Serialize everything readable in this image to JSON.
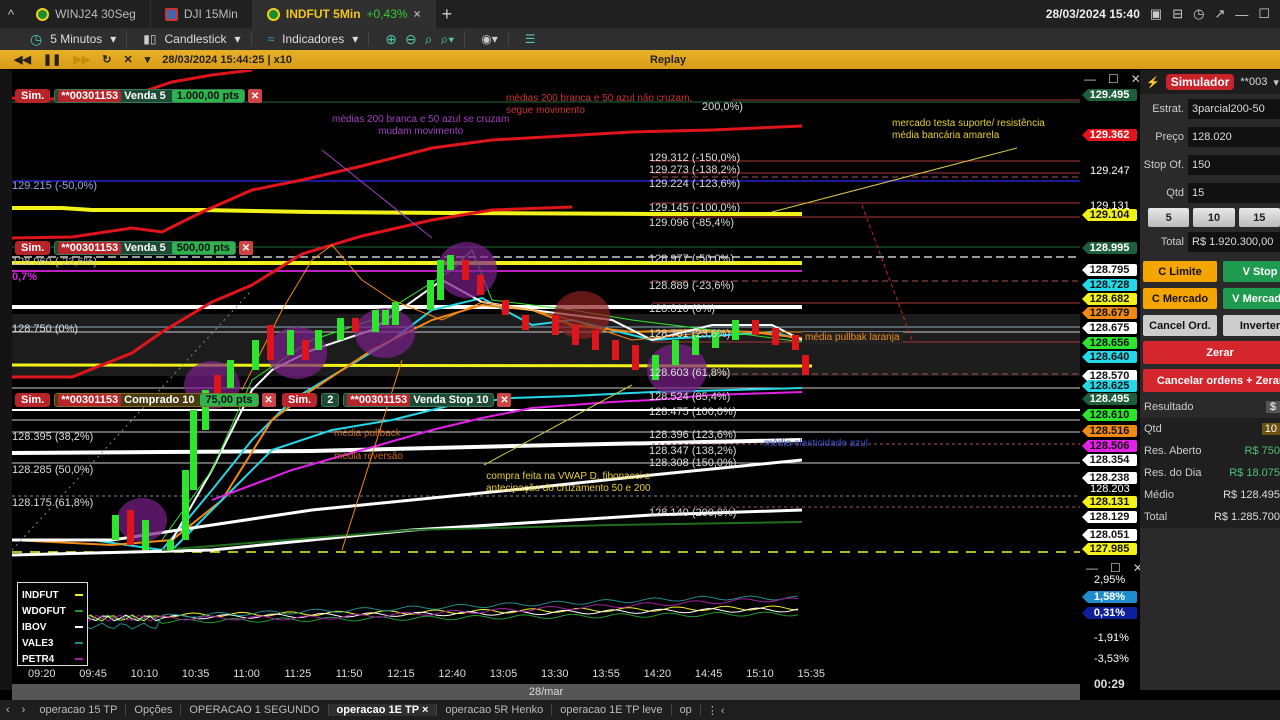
{
  "tabs": [
    {
      "label": "WINJ24 30Seg",
      "flag": "br"
    },
    {
      "label": "DJI 15Min",
      "flag": "us"
    },
    {
      "label": "INDFUT 5Min",
      "change": "+0,43%",
      "active": true,
      "flag": "br"
    }
  ],
  "header": {
    "datetime": "28/03/2024 15:40"
  },
  "toolbar": {
    "interval": "5 Minutos",
    "chart_type": "Candlestick",
    "indicators": "Indicadores"
  },
  "replay": {
    "timestamp": "28/03/2024 15:44:25 | x10",
    "title": "Replay"
  },
  "orders": [
    {
      "sim": "Sim.",
      "account": "**00301153",
      "label": "Venda 5",
      "pts": "1.000,00 pts"
    },
    {
      "sim": "Sim.",
      "account": "**00301153",
      "label": "Venda 5",
      "pts": "500,00 pts"
    },
    {
      "sim": "Sim.",
      "account": "**00301153",
      "label": "Comprado 10",
      "pts": "75,00 pts"
    },
    {
      "sim": "Sim.",
      "count": "2",
      "account": "**00301153",
      "label": "Venda Stop 10"
    }
  ],
  "fib_labels": [
    "129.215 (-50,0%)",
    "128.969 (-23,6%)",
    "0,7%",
    "128.750 (0%)",
    "128.395 (38,2%)",
    "128.285 (50,0%)",
    "128.175 (61,8%)",
    "200,0%)",
    "129.312 (-150,0%)",
    "129.273 (-138,2%)",
    "129.224 (-123,6%)",
    "129.145 (-100,0%)",
    "129.096 (-85,4%)",
    "128.977 (-50,0%)",
    "128.889 (-23,6%)",
    "128.810 (0%)",
    "128.731 (23,6%)",
    "128.603 (61,8%)",
    "128.524 (85,4%)",
    "128.475 (100,0%)",
    "128.396 (123,6%)",
    "128.347 (138,2%)",
    "128.308 (150,0%)",
    "128.140 (200,0%)"
  ],
  "annotations": {
    "a1": "médias 200 branca e 50 azul se cruzam\nmudam movimento",
    "a2": "médias 200 branca e 50 azul não cruzam,\nsegue movimento",
    "a3": "mercado testa suporte/ resistência\nmédia bancária amarela",
    "a4": "média pullbak laranja",
    "a5": "média pullback",
    "a6": "média reversão",
    "a7": "compra feita na VWAP D, fibonacci e\nantecipação do cruzamento 50 e 200",
    "a8": "média elasticidade azul"
  },
  "price_axis": [
    {
      "v": "129.495",
      "bg": "#1e5e3a",
      "fg": "#fff"
    },
    {
      "v": "129.362",
      "bg": "#e0151b",
      "fg": "#fff"
    },
    {
      "v": "129.247",
      "plain": true
    },
    {
      "v": "129.131",
      "plain": true
    },
    {
      "v": "129.104",
      "bg": "#f2f21a",
      "fg": "#111"
    },
    {
      "v": "128.995",
      "bg": "#1e5e3a",
      "fg": "#fff"
    },
    {
      "v": "128.795",
      "bg": "#fff",
      "fg": "#111"
    },
    {
      "v": "128.728",
      "bg": "#26d7e8",
      "fg": "#111"
    },
    {
      "v": "128.682",
      "bg": "#f2f21a",
      "fg": "#111"
    },
    {
      "v": "128.679",
      "bg": "#f08a14",
      "fg": "#111"
    },
    {
      "v": "128.675",
      "bg": "#fff",
      "fg": "#111"
    },
    {
      "v": "128.656",
      "bg": "#2ee52e",
      "fg": "#111"
    },
    {
      "v": "128.640",
      "bg": "#26d7e8",
      "fg": "#111"
    },
    {
      "v": "128.570",
      "bg": "#fff",
      "fg": "#111"
    },
    {
      "v": "128.625",
      "bg": "#26d7e8",
      "fg": "#111"
    },
    {
      "v": "128.495",
      "bg": "#1e5e3a",
      "fg": "#fff"
    },
    {
      "v": "128.610",
      "bg": "#2ee52e",
      "fg": "#111"
    },
    {
      "v": "128.516",
      "bg": "#f08a14",
      "fg": "#111"
    },
    {
      "v": "128.506",
      "bg": "#e41fe8",
      "fg": "#111"
    },
    {
      "v": "128.354",
      "bg": "#fff",
      "fg": "#111"
    },
    {
      "v": "128.238",
      "bg": "#fff",
      "fg": "#111"
    },
    {
      "v": "128.203",
      "plain": true
    },
    {
      "v": "128.131",
      "bg": "#f2f21a",
      "fg": "#111"
    },
    {
      "v": "128.129",
      "bg": "#fff",
      "fg": "#111"
    },
    {
      "v": "128.051",
      "bg": "#fff",
      "fg": "#111"
    },
    {
      "v": "127.985",
      "bg": "#f2f21a",
      "fg": "#111"
    }
  ],
  "indicator_axis": [
    {
      "v": "2,95%",
      "plain": true
    },
    {
      "v": "1,58%",
      "bg": "#1f8ccc",
      "fg": "#fff"
    },
    {
      "v": "0,31%",
      "bg": "#0f1f9a",
      "fg": "#fff"
    },
    {
      "v": "-1,91%",
      "plain": true
    },
    {
      "v": "-3,53%",
      "plain": true
    }
  ],
  "clock": "00:29",
  "legend": [
    {
      "name": "INDFUT",
      "color": "#f2f21a"
    },
    {
      "name": "WDOFUT",
      "color": "#1e9b30"
    },
    {
      "name": "IBOV",
      "color": "#ffffff"
    },
    {
      "name": "VALE3",
      "color": "#1f8c8c"
    },
    {
      "name": "PETR4",
      "color": "#a020a0"
    }
  ],
  "time_ticks": [
    "09:20",
    "09:45",
    "10:10",
    "10:35",
    "11:00",
    "11:25",
    "11:50",
    "12:15",
    "12:40",
    "13:05",
    "13:30",
    "13:55",
    "14:20",
    "14:45",
    "15:10",
    "15:35"
  ],
  "date": "28/mar",
  "panel": {
    "title": "Simulador",
    "account": "**003",
    "estrat_label": "Estrat.",
    "estrat": "3parcial200-50",
    "preco_label": "Preço",
    "preco": "128.020",
    "stop_label": "Stop Of.",
    "stop": "150",
    "qtd_label": "Qtd",
    "qtd": "15",
    "quick": [
      "5",
      "10",
      "15"
    ],
    "total_label": "Total",
    "total": "R$ 1.920.300,00",
    "c_limite": "C Limite",
    "v_stop": "V Stop",
    "c_mercado": "C Mercado",
    "v_mercado": "V Mercado",
    "cancel": "Cancel Ord.",
    "inverter": "Inverter",
    "zerar": "Zerar",
    "cancel_zerar": "Cancelar ordens + Zerar",
    "resultado": "Resultado",
    "res_unit": "$",
    "qtd2_label": "Qtd",
    "qtd2": "10",
    "aberto_label": "Res. Aberto",
    "aberto": "R$ 750",
    "dia_label": "Res. do Dia",
    "dia": "R$ 18.075",
    "medio_label": "Médio",
    "medio": "R$ 128.495",
    "total2_label": "Total",
    "total2": "R$ 1.285.700"
  },
  "bottom_tabs": [
    "operacao 15 TP",
    "Opções",
    "OPERACAO 1 SEGUNDO",
    "operacao 1E TP",
    "operacao 5R Henko",
    "operacao 1E TP leve",
    "op"
  ],
  "active_bottom_tab": "operacao 1E TP"
}
